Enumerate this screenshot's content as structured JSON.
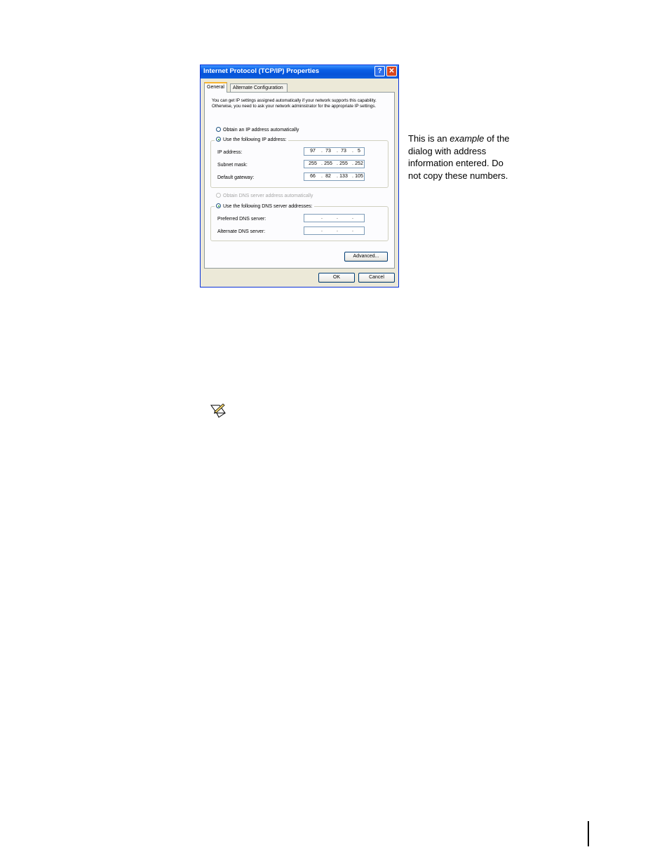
{
  "dialog": {
    "title": "Internet Protocol (TCP/IP) Properties",
    "help_button": "?",
    "close_button": "✕",
    "tabs": [
      {
        "label": "General",
        "active": true
      },
      {
        "label": "Alternate Configuration",
        "active": false
      }
    ],
    "description": "You can get IP settings assigned automatically if your network supports this capability. Otherwise, you need to ask your network administrator for the appropriate IP settings.",
    "ip_auto_label": "Obtain an IP address automatically",
    "ip_manual_label": "Use the following IP address:",
    "ip_fields": [
      {
        "label": "IP address:",
        "octets": [
          "97",
          "73",
          "73",
          "5"
        ]
      },
      {
        "label": "Subnet mask:",
        "octets": [
          "255",
          "255",
          "255",
          "252"
        ]
      },
      {
        "label": "Default gateway:",
        "octets": [
          "66",
          "82",
          "133",
          "105"
        ]
      }
    ],
    "dns_auto_label": "Obtain DNS server address automatically",
    "dns_manual_label": "Use the following DNS server addresses:",
    "dns_fields": [
      {
        "label": "Preferred DNS server:",
        "octets": [
          "",
          "",
          "",
          ""
        ]
      },
      {
        "label": "Alternate DNS server:",
        "octets": [
          "",
          "",
          "",
          ""
        ]
      }
    ],
    "advanced_button": "Advanced...",
    "ok_button": "OK",
    "cancel_button": "Cancel"
  },
  "caption": {
    "before": "This is an ",
    "emphasis": "example",
    "after": " of the dialog with address information entered. Do not copy these numbers."
  },
  "colors": {
    "titlebar": "#0553d9",
    "close": "#d6461f",
    "dialog_bg": "#ece9d8",
    "panel_bg": "#fcfcfe",
    "active_tab_accent": "#f7b42f"
  },
  "icons": {
    "note": "note-pencil-icon"
  }
}
